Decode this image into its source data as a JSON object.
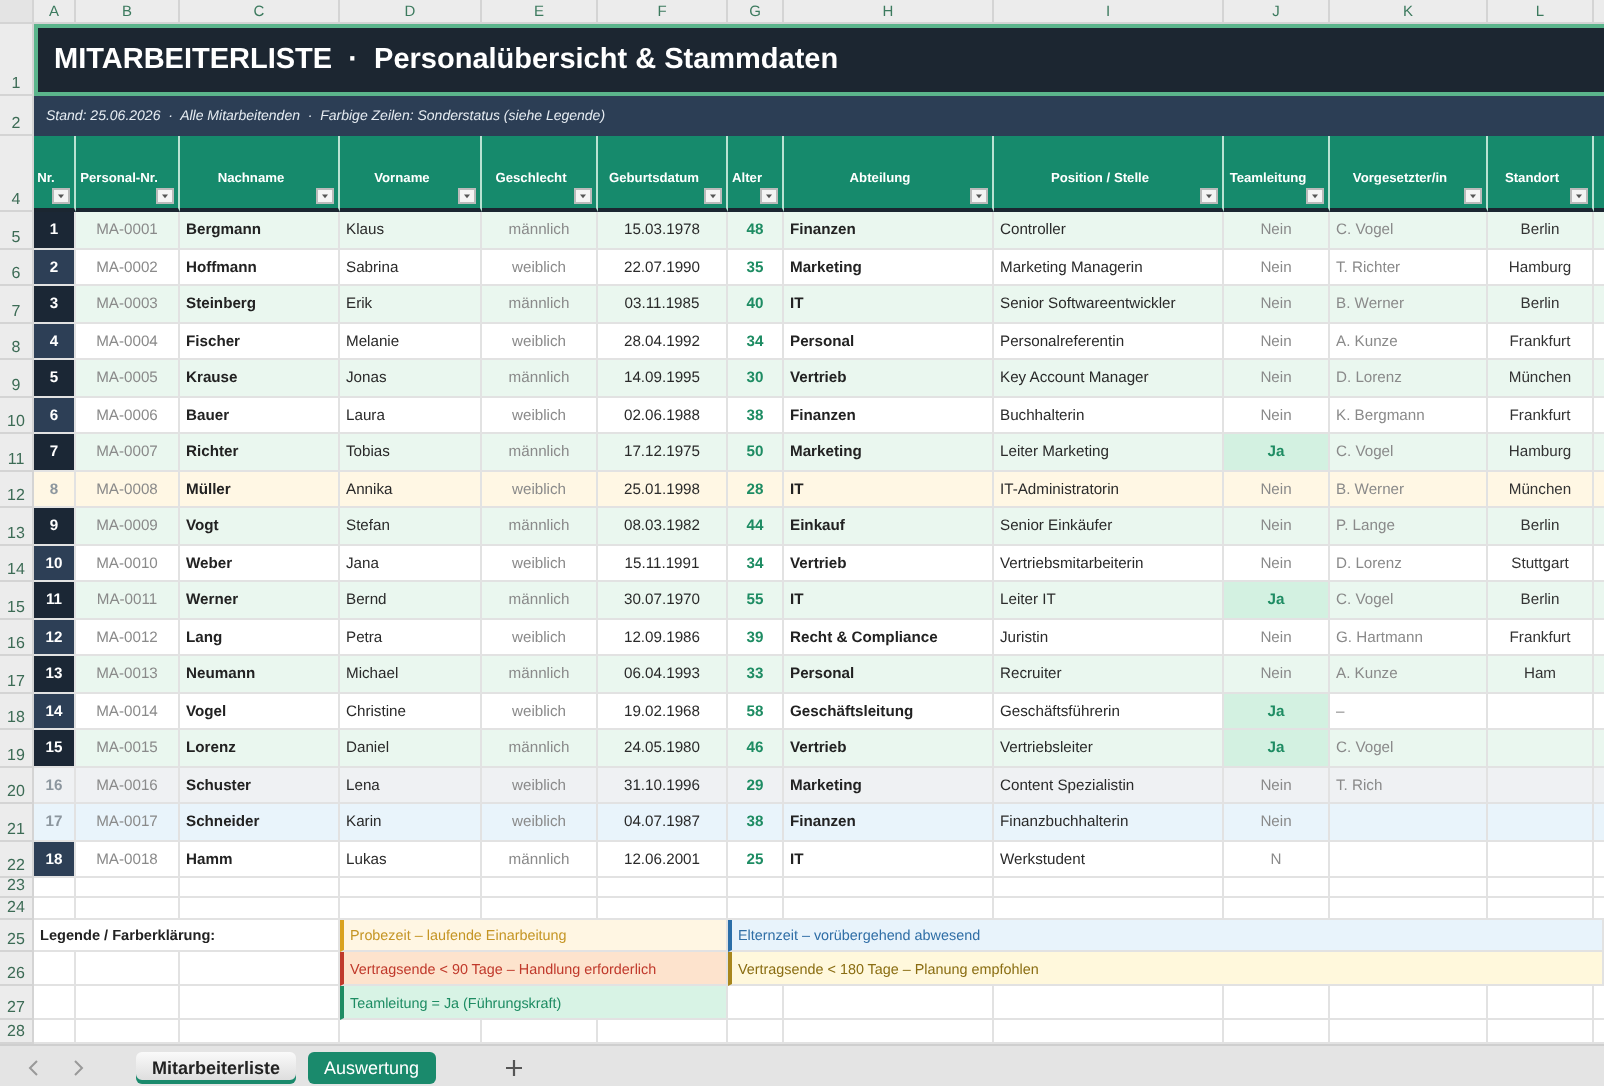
{
  "column_letters": [
    "A",
    "B",
    "C",
    "D",
    "E",
    "F",
    "G",
    "H",
    "I",
    "J",
    "K",
    "L"
  ],
  "title": {
    "row_number": "1",
    "text": "MITARBEITERLISTE  ·  Personalübersicht & Stammdaten"
  },
  "info": {
    "row_number": "2",
    "text": "Stand: 25.06.2026  ·  Alle Mitarbeitenden  ·  Farbige Zeilen: Sonderstatus (siehe Legende)"
  },
  "header": {
    "row_number": "4",
    "columns": [
      "Nr.",
      "Personal-Nr.",
      "Nachname",
      "Vorname",
      "Geschlecht",
      "Geburtsdatum",
      "Alter",
      "Abteilung",
      "Position / Stelle",
      "Teamleitung",
      "Vorgesetzter/in",
      "Standort"
    ]
  },
  "rows": [
    {
      "row_number": "5",
      "lead": false,
      "cells": [
        "1",
        "MA-0001",
        "Bergmann",
        "Klaus",
        "männlich",
        "15.03.1978",
        "48",
        "Finanzen",
        "Controller",
        "Nein",
        "C. Vogel",
        "Berlin"
      ]
    },
    {
      "row_number": "6",
      "lead": false,
      "cells": [
        "2",
        "MA-0002",
        "Hoffmann",
        "Sabrina",
        "weiblich",
        "22.07.1990",
        "35",
        "Marketing",
        "Marketing Managerin",
        "Nein",
        "T. Richter",
        "Hamburg"
      ]
    },
    {
      "row_number": "7",
      "lead": false,
      "cells": [
        "3",
        "MA-0003",
        "Steinberg",
        "Erik",
        "männlich",
        "03.11.1985",
        "40",
        "IT",
        "Senior Softwareentwickler",
        "Nein",
        "B. Werner",
        "Berlin"
      ]
    },
    {
      "row_number": "8",
      "lead": false,
      "cells": [
        "4",
        "MA-0004",
        "Fischer",
        "Melanie",
        "weiblich",
        "28.04.1992",
        "34",
        "Personal",
        "Personalreferentin",
        "Nein",
        "A. Kunze",
        "Frankfurt"
      ]
    },
    {
      "row_number": "9",
      "lead": false,
      "cells": [
        "5",
        "MA-0005",
        "Krause",
        "Jonas",
        "männlich",
        "14.09.1995",
        "30",
        "Vertrieb",
        "Key Account Manager",
        "Nein",
        "D. Lorenz",
        "München"
      ]
    },
    {
      "row_number": "10",
      "lead": false,
      "cells": [
        "6",
        "MA-0006",
        "Bauer",
        "Laura",
        "weiblich",
        "02.06.1988",
        "38",
        "Finanzen",
        "Buchhalterin",
        "Nein",
        "K. Bergmann",
        "Frankfurt"
      ]
    },
    {
      "row_number": "11",
      "lead": true,
      "cells": [
        "7",
        "MA-0007",
        "Richter",
        "Tobias",
        "männlich",
        "17.12.1975",
        "50",
        "Marketing",
        "Leiter Marketing",
        "Ja",
        "C. Vogel",
        "Hamburg"
      ]
    },
    {
      "row_number": "12",
      "color": "#fff7e4",
      "lead": false,
      "cells": [
        "8",
        "MA-0008",
        "Müller",
        "Annika",
        "weiblich",
        "25.01.1998",
        "28",
        "IT",
        "IT-Administratorin",
        "Nein",
        "B. Werner",
        "München"
      ]
    },
    {
      "row_number": "13",
      "lead": false,
      "cells": [
        "9",
        "MA-0009",
        "Vogt",
        "Stefan",
        "männlich",
        "08.03.1982",
        "44",
        "Einkauf",
        "Senior Einkäufer",
        "Nein",
        "P. Lange",
        "Berlin"
      ]
    },
    {
      "row_number": "14",
      "lead": false,
      "cells": [
        "10",
        "MA-0010",
        "Weber",
        "Jana",
        "weiblich",
        "15.11.1991",
        "34",
        "Vertrieb",
        "Vertriebsmitarbeiterin",
        "Nein",
        "D. Lorenz",
        "Stuttgart"
      ]
    },
    {
      "row_number": "15",
      "lead": true,
      "cells": [
        "11",
        "MA-0011",
        "Werner",
        "Bernd",
        "männlich",
        "30.07.1970",
        "55",
        "IT",
        "Leiter IT",
        "Ja",
        "C. Vogel",
        "Berlin"
      ]
    },
    {
      "row_number": "16",
      "lead": false,
      "cells": [
        "12",
        "MA-0012",
        "Lang",
        "Petra",
        "weiblich",
        "12.09.1986",
        "39",
        "Recht & Compliance",
        "Juristin",
        "Nein",
        "G. Hartmann",
        "Frankfurt"
      ]
    },
    {
      "row_number": "17",
      "lead": false,
      "cells": [
        "13",
        "MA-0013",
        "Neumann",
        "Michael",
        "männlich",
        "06.04.1993",
        "33",
        "Personal",
        "Recruiter",
        "Nein",
        "A. Kunze",
        "Ham"
      ]
    },
    {
      "row_number": "18",
      "lead": true,
      "cells": [
        "14",
        "MA-0014",
        "Vogel",
        "Christine",
        "weiblich",
        "19.02.1968",
        "58",
        "Geschäftsleitung",
        "Geschäftsführerin",
        "Ja",
        "–",
        ""
      ]
    },
    {
      "row_number": "19",
      "lead": true,
      "cells": [
        "15",
        "MA-0015",
        "Lorenz",
        "Daniel",
        "männlich",
        "24.05.1980",
        "46",
        "Vertrieb",
        "Vertriebsleiter",
        "Ja",
        "C. Vogel",
        ""
      ]
    },
    {
      "row_number": "20",
      "color": "#eff1f3",
      "lead": false,
      "cells": [
        "16",
        "MA-0016",
        "Schuster",
        "Lena",
        "weiblich",
        "31.10.1996",
        "29",
        "Marketing",
        "Content Spezialistin",
        "Nein",
        "T. Rich",
        ""
      ]
    },
    {
      "row_number": "21",
      "color": "#e9f4fb",
      "lead": false,
      "cells": [
        "17",
        "MA-0017",
        "Schneider",
        "Karin",
        "weiblich",
        "04.07.1987",
        "38",
        "Finanzen",
        "Finanzbuchhalterin",
        "Nein",
        "",
        ""
      ]
    },
    {
      "row_number": "22",
      "lead": false,
      "cells": [
        "18",
        "MA-0018",
        "Hamm",
        "Lukas",
        "männlich",
        "12.06.2001",
        "25",
        "IT",
        "Werkstudent",
        "N",
        "",
        ""
      ]
    }
  ],
  "empty_rows": [
    "23",
    "24"
  ],
  "legend": {
    "title": "Legende / Farberklärung:",
    "rows": [
      {
        "row_number": "25",
        "items": [
          {
            "kind": "probezeit",
            "text": "Probezeit – laufende Einarbeitung"
          },
          {
            "kind": "elternzeit",
            "text": "Elternzeit – vorübergehend abwesend"
          }
        ]
      },
      {
        "row_number": "26",
        "items": [
          {
            "kind": "vertragsende90",
            "text": "Vertragsende < 90 Tage – Handlung erforderlich"
          },
          {
            "kind": "vertragsende180",
            "text": "Vertragsende < 180 Tage – Planung empfohlen"
          }
        ]
      },
      {
        "row_number": "27",
        "items": [
          {
            "kind": "teamleitung",
            "text": "Teamleitung = Ja (Führungskraft)"
          }
        ]
      },
      {
        "row_number": "28",
        "items": []
      }
    ]
  },
  "sheet_tabs": [
    {
      "label": "Mitarbeiterliste",
      "selected": true
    },
    {
      "label": "Auswertung",
      "selected": false,
      "color": "#1a8a6c"
    }
  ]
}
